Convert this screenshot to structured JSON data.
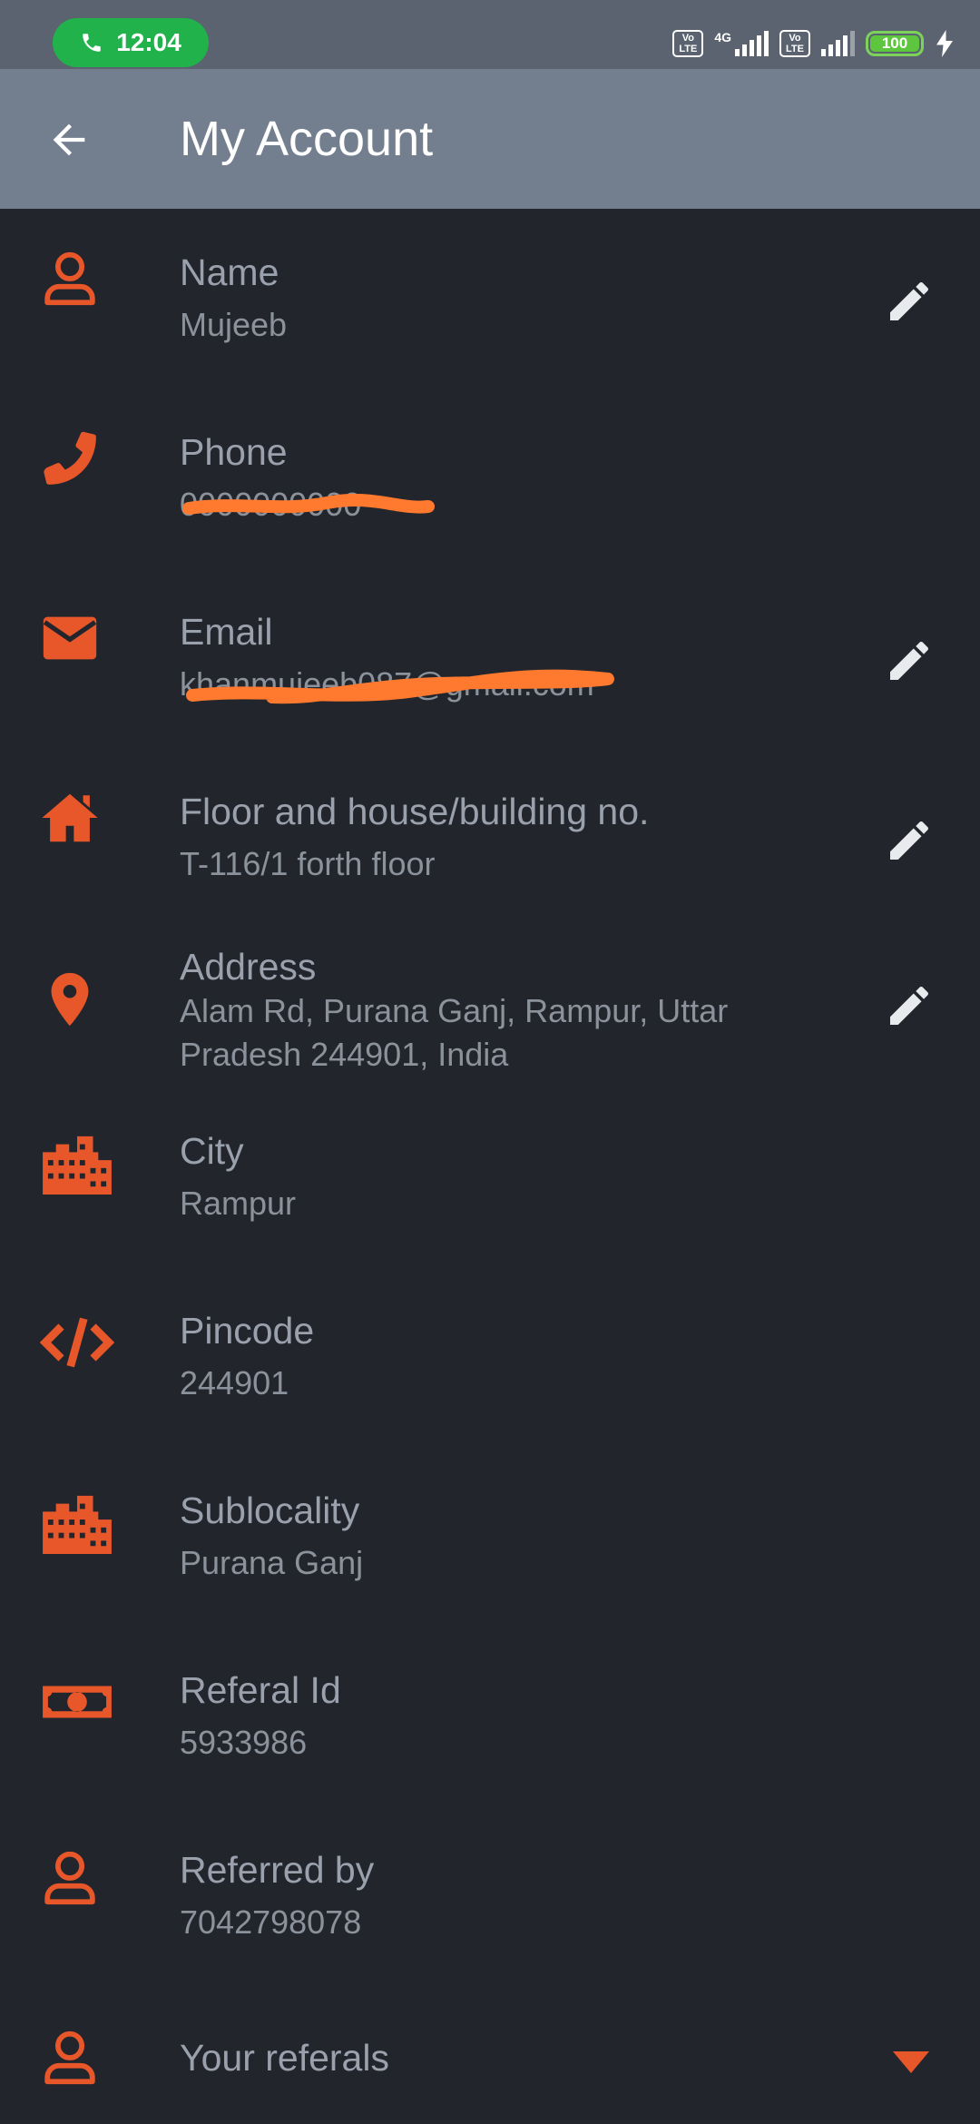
{
  "status_bar": {
    "time": "12:04",
    "network_label": "4G",
    "volte_label": "Vo LTE",
    "battery": "100"
  },
  "header": {
    "title": "My Account"
  },
  "fields": {
    "name": {
      "label": "Name",
      "value": "Mujeeb"
    },
    "phone": {
      "label": "Phone",
      "value": "0000000000"
    },
    "email": {
      "label": "Email",
      "value": "khanmujeeb087@gmail.com"
    },
    "floor": {
      "label": "Floor and house/building no.",
      "value": "T-116/1 forth floor"
    },
    "address": {
      "label": "Address",
      "value": "Alam Rd, Purana Ganj, Rampur, Uttar Pradesh 244901, India"
    },
    "city": {
      "label": "City",
      "value": "Rampur"
    },
    "pincode": {
      "label": "Pincode",
      "value": "244901"
    },
    "sublocality": {
      "label": "Sublocality",
      "value": "Purana Ganj"
    },
    "referral_id": {
      "label": "Referal Id",
      "value": "5933986"
    },
    "referred_by": {
      "label": "Referred by",
      "value": "7042798078"
    },
    "your_referrals": {
      "label": "Your referals"
    }
  },
  "colors": {
    "accent": "#e8572a",
    "background": "#22252c",
    "appbar": "#737f8f",
    "statusbar": "#5a636f",
    "redaction": "#ff7a2e"
  },
  "icons": {
    "back": "arrow-left-icon",
    "name": "person-icon",
    "phone": "phone-icon",
    "email": "envelope-icon",
    "floor": "house-icon",
    "address": "map-pin-icon",
    "city": "city-buildings-icon",
    "pincode": "code-icon",
    "sublocality": "city-buildings-icon",
    "referral_id": "banknote-icon",
    "referred_by": "person-icon",
    "your_referrals": "person-icon",
    "edit": "pencil-icon",
    "expand": "caret-down-icon"
  }
}
